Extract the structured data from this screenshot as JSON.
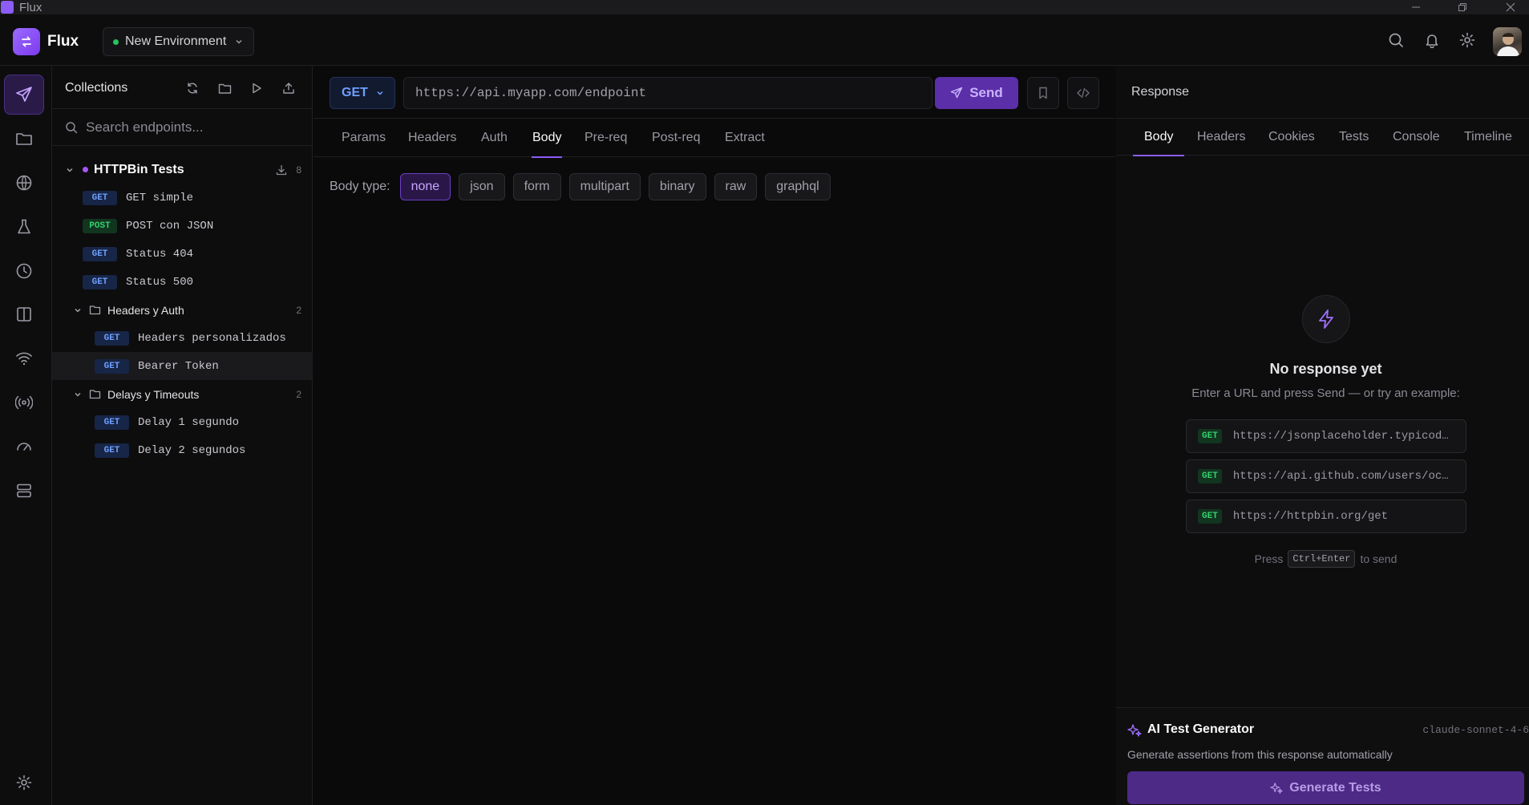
{
  "window": {
    "title": "Flux"
  },
  "header": {
    "brand": "Flux",
    "environment": "New Environment"
  },
  "sidebar": {
    "title": "Collections",
    "search_placeholder": "Search endpoints...",
    "collection": {
      "name": "HTTPBin Tests",
      "count": "8"
    },
    "requests": [
      {
        "method": "GET",
        "name": "GET simple"
      },
      {
        "method": "POST",
        "name": "POST con JSON"
      },
      {
        "method": "GET",
        "name": "Status 404"
      },
      {
        "method": "GET",
        "name": "Status 500"
      }
    ],
    "folders": [
      {
        "name": "Headers y Auth",
        "count": "2",
        "items": [
          {
            "method": "GET",
            "name": "Headers personalizados"
          },
          {
            "method": "GET",
            "name": "Bearer Token"
          }
        ]
      },
      {
        "name": "Delays y Timeouts",
        "count": "2",
        "items": [
          {
            "method": "GET",
            "name": "Delay 1 segundo"
          },
          {
            "method": "GET",
            "name": "Delay 2 segundos"
          }
        ]
      }
    ]
  },
  "request": {
    "method": "GET",
    "url_placeholder": "https://api.myapp.com/endpoint",
    "send_label": "Send",
    "tabs": [
      "Params",
      "Headers",
      "Auth",
      "Body",
      "Pre-req",
      "Post-req",
      "Extract"
    ],
    "active_tab": "Body",
    "body_type_label": "Body type:",
    "body_types": [
      "none",
      "json",
      "form",
      "multipart",
      "binary",
      "raw",
      "graphql"
    ],
    "active_body_type": "none"
  },
  "response": {
    "title": "Response",
    "tabs": [
      "Body",
      "Headers",
      "Cookies",
      "Tests",
      "Console",
      "Timeline"
    ],
    "active_tab": "Body",
    "empty_title": "No response yet",
    "empty_subtitle": "Enter a URL and press Send — or try an example:",
    "examples": [
      {
        "method": "GET",
        "url": "https://jsonplaceholder.typicod…"
      },
      {
        "method": "GET",
        "url": "https://api.github.com/users/oc…"
      },
      {
        "method": "GET",
        "url": "https://httpbin.org/get"
      }
    ],
    "hint_press": "Press",
    "hint_key": "Ctrl+Enter",
    "hint_suffix": "to send"
  },
  "ai": {
    "title": "AI Test Generator",
    "model": "claude-sonnet-4-6",
    "description": "Generate assertions from this response automatically",
    "button_label": "Generate Tests"
  },
  "colors": {
    "accent": "#8b5cf6",
    "get": "#6ea0ff",
    "post": "#35d16e",
    "env_dot": "#22c55e"
  },
  "icons": [
    "send-icon",
    "folder-icon",
    "globe-icon",
    "flask-icon",
    "clock-icon",
    "columns-icon",
    "wifi-icon",
    "broadcast-icon",
    "gauge-icon",
    "server-icon",
    "gear-icon",
    "search-icon",
    "bell-icon",
    "refresh-icon",
    "play-icon",
    "upload-icon",
    "download-icon",
    "bookmark-icon",
    "code-icon",
    "bolt-icon",
    "sparkles-icon"
  ]
}
